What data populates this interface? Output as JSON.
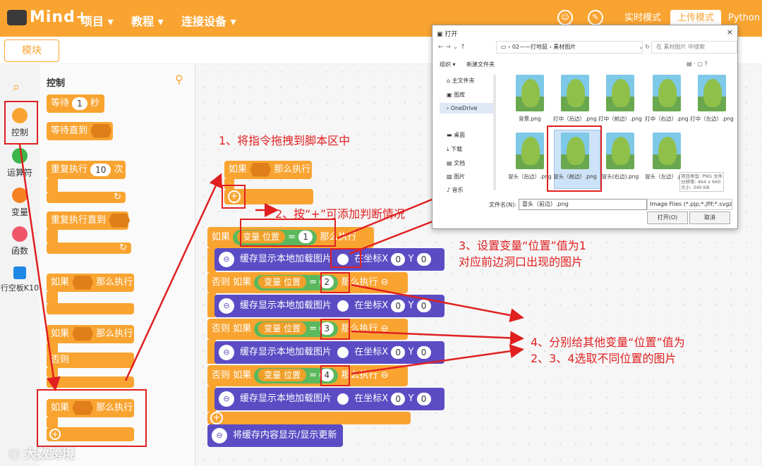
{
  "app": {
    "logo": "Mind+",
    "menus": [
      "项目 ▾",
      "教程 ▾",
      "连接设备 ▾"
    ],
    "modes": [
      "实时模式",
      "上传模式",
      "Python模"
    ],
    "modules_tab": "模块"
  },
  "categories": [
    {
      "label": "控制",
      "color": "#f9a431"
    },
    {
      "label": "运算符",
      "color": "#3cb54a"
    },
    {
      "label": "变量",
      "color": "#f58220"
    },
    {
      "label": "函数",
      "color": "#f0566a"
    },
    {
      "label": "行空板K10",
      "color": "#1e88e5"
    }
  ],
  "palette": {
    "title": "控制",
    "wait_pre": "等待",
    "wait_val": "1",
    "wait_post": "秒",
    "wait_until": "等待直到",
    "repeat_pre": "重复执行",
    "repeat_val": "10",
    "repeat_post": "次",
    "repeat_until": "重复执行直到",
    "if_then": "如果",
    "then": "那么执行",
    "else": "否则"
  },
  "script": {
    "if": "如果",
    "then": "那么执行",
    "elseif": "否则 如果",
    "var_label": "变量 位置",
    "eq": "=",
    "vals": [
      "1",
      "2",
      "3",
      "4"
    ],
    "load_img": "缓存显示本地加载图片",
    "at_x": "在坐标X",
    "x_val": "0",
    "y_label": "Y",
    "y_val": "0",
    "flush": "将缓存内容显示/显示更新",
    "ext_icon": "K10"
  },
  "annotations": {
    "a1": "1、将指令拖拽到脚本区中",
    "a2": "2、按“+”可添加判断情况",
    "a3_line1": "3、设置变量“位置”值为1",
    "a3_line2": "对应前边洞口出现的图片",
    "a4_line1": "4、分别给其他变量“位置”值为",
    "a4_line2": "2、3、4选取不同位置的图片"
  },
  "dialog": {
    "title": "打开",
    "path": "02——打地鼠 › 素材图片",
    "search_placeholder": "在 素材图片 中搜索",
    "toolbar_organize": "组织 ▾",
    "toolbar_newfolder": "新建文件夹",
    "nav": [
      "主文件夹",
      "图库",
      "OneDrive",
      "桌面",
      "下载",
      "文档",
      "图片",
      "音乐"
    ],
    "files_row1": [
      "背景.png",
      "打中（后边）.png",
      "打中（前边）.png",
      "打中（右边）.png",
      "打中（左边）.png"
    ],
    "files_row2": [
      "冒头（后边）.png",
      "冒头（前边）.png",
      "冒头(右边).png",
      "冒头（左边）.png"
    ],
    "tooltip_lines": [
      "项目类型: PNG 文件",
      "分辨率: 464 x 660",
      "大小: 340 KB"
    ],
    "filename_label": "文件名(N):",
    "filename_value": "冒头（前边）.png",
    "filter": "Image Files (*.pjp;*.jfif;*.svgz;* ▾",
    "open_button": "打开(O)",
    "cancel_button": "取消"
  },
  "watermark": "大数跨境"
}
